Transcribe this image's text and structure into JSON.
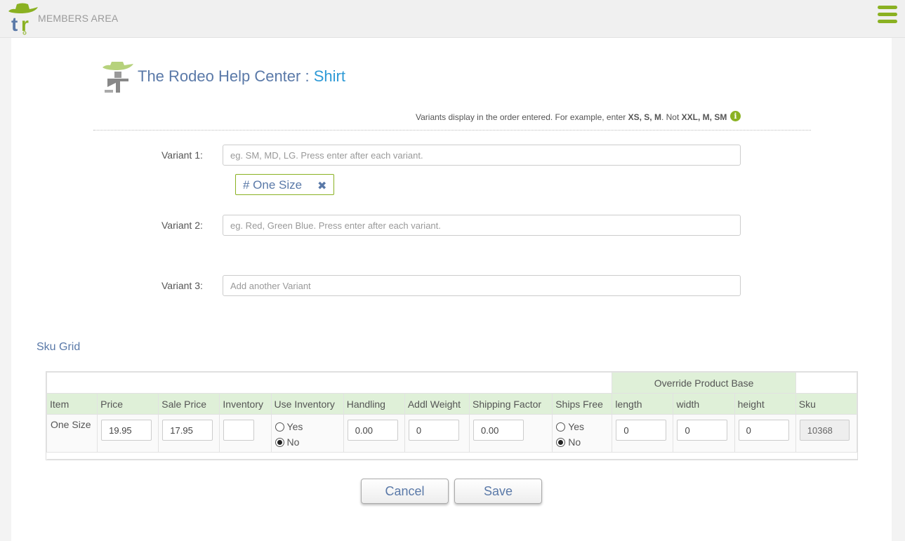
{
  "header": {
    "brand_label": "MEMBERS AREA",
    "accent_color": "#8ab122",
    "menu_icon": "hamburger-icon"
  },
  "page": {
    "title": "The Rodeo Help Center :",
    "subtitle": "Shirt"
  },
  "hint": {
    "text": "Variants display in the order entered. For example, enter",
    "example_good": "XS, S, M",
    "separator": ". Not",
    "example_bad": "XXL, M, SM",
    "icon": "info-icon"
  },
  "variants": [
    {
      "label": "Variant 1:",
      "placeholder": "eg. SM, MD, LG. Press enter after each variant.",
      "value": ""
    },
    {
      "label": "Variant 2:",
      "placeholder": "eg. Red, Green Blue. Press enter after each variant.",
      "value": ""
    },
    {
      "label": "Variant 3:",
      "placeholder": "Add another Variant",
      "value": ""
    }
  ],
  "variant1_tags": [
    {
      "label": "# One Size",
      "remove_icon": "close-icon"
    }
  ],
  "sku_grid": {
    "title": "Sku Grid",
    "group_header": "Override Product Base",
    "columns": [
      "Item",
      "Price",
      "Sale Price",
      "Inventory",
      "Use Inventory",
      "Handling",
      "Addl Weight",
      "Shipping Factor",
      "Ships Free",
      "length",
      "width",
      "height",
      "Sku"
    ],
    "rows": [
      {
        "item": "One Size",
        "price": "19.95",
        "sale_price": "17.95",
        "inventory": "",
        "use_inventory_yes": "Yes",
        "use_inventory_no": "No",
        "use_inventory_selected": "No",
        "handling": "0.00",
        "addl_weight": "0",
        "shipping_factor": "0.00",
        "ships_free_yes": "Yes",
        "ships_free_no": "No",
        "ships_free_selected": "No",
        "length": "0",
        "width": "0",
        "height": "0",
        "sku": "10368"
      }
    ]
  },
  "actions": {
    "cancel_label": "Cancel",
    "save_label": "Save"
  }
}
